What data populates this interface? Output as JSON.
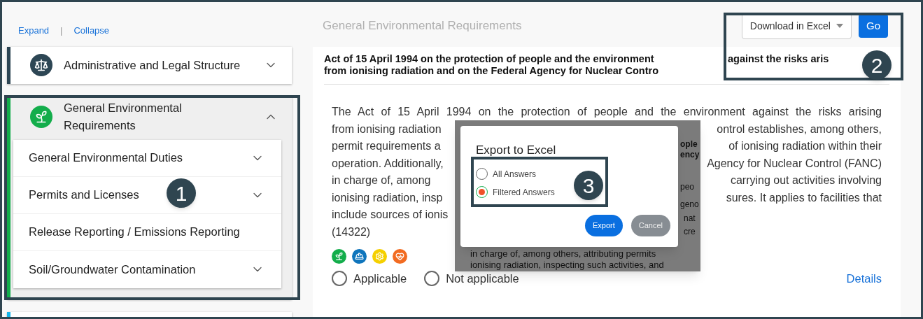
{
  "outline": {
    "expand_link": "Expand",
    "separator": "|",
    "collapse_link": "Collapse",
    "categories": [
      {
        "title": "Administrative and Legal Structure",
        "color": "#2d4654",
        "expanded": false
      },
      {
        "title": "General Environmental Requirements",
        "color": "#13ad4b",
        "expanded": true,
        "children": [
          {
            "label": "General Environmental Duties",
            "kind": "group"
          },
          {
            "label": "Permits and Licenses",
            "kind": "group"
          },
          {
            "label": "Release Reporting / Emissions Reporting",
            "kind": "leaf"
          },
          {
            "label": "Soil/Groundwater Contamination",
            "kind": "group"
          }
        ]
      }
    ],
    "next_category": {
      "color": "#13b5ea"
    }
  },
  "section_title": "General Environmental Requirements",
  "export_bar": {
    "dropdown": "Download in Excel",
    "go_button": "Go"
  },
  "requirement": {
    "title": {
      "line_1_start": "Act of 15 April 1994 on the protection of people and the environment",
      "line_1_end": "against the risks aris",
      "line_2": "from ionising radiation and on the Federal Agency for Nuclear Contro"
    },
    "lines": [
      {
        "left": "The Act of 15 April 1994 on the protection of people and the environment against the risks arising"
      },
      {
        "left": "from ionising radiation",
        "right": "ontrol establishes, among others,"
      },
      {
        "left": "permit requirements a",
        "right": "of ionising radiation within their"
      },
      {
        "left": "operation. Additionally,",
        "right": "Agency for Nuclear Control (FANC)"
      },
      {
        "left": "in charge of, among",
        "right": "carrying out activities involving"
      },
      {
        "left": "ionising radiation, insp",
        "right": "sures. It applies to facilities that"
      },
      {
        "left": "include sources of ionis"
      },
      {
        "left": "(14322)"
      }
    ],
    "topic_icons": [
      {
        "color": "#13ad4b"
      },
      {
        "color": "#0f75bc"
      },
      {
        "color": "#f5d000"
      },
      {
        "color": "#f26b21"
      }
    ],
    "options": [
      {
        "label": "Applicable",
        "selected": false
      },
      {
        "label": "Not applicable",
        "selected": false
      }
    ],
    "details_link": "Details"
  },
  "underlying_snippet": {
    "fragments": [
      "ople",
      "ency",
      "peo",
      "geno",
      "nat",
      "cre"
    ],
    "lines": [
      "in charge of, among others, attributing permits",
      "ionising radiation, inspecting such activities, and"
    ]
  },
  "dialog": {
    "title": "Export to Excel",
    "options": [
      {
        "label": "All Answers",
        "selected": false
      },
      {
        "label": "Filtered Answers",
        "selected": true
      }
    ],
    "buttons": [
      {
        "label": "Export",
        "kind": "primary"
      },
      {
        "label": "Cancel",
        "kind": "secondary"
      }
    ]
  },
  "callouts": [
    {
      "number": "1"
    },
    {
      "number": "2"
    },
    {
      "number": "3"
    }
  ]
}
